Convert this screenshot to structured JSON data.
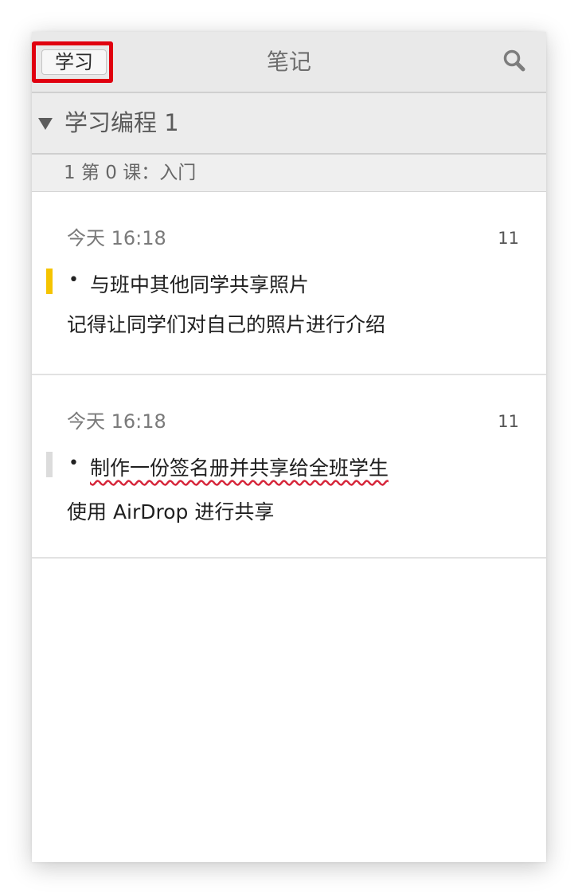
{
  "toolbar": {
    "back_label": "学习",
    "title": "笔记",
    "search_icon": "search-icon"
  },
  "group": {
    "title": "学习编程 1",
    "expanded": true
  },
  "section": {
    "label": "1  第 0 课：入门"
  },
  "notes": [
    {
      "date": "今天 16:18",
      "count": "11",
      "heading": "与班中其他同学共享照片",
      "body": "记得让同学们对自己的照片进行介绍",
      "flag_color": "#f5c400"
    },
    {
      "date": "今天 16:18",
      "count": "11",
      "heading": "制作一份签名册并共享给全班学生",
      "body": "使用 AirDrop 进行共享",
      "flag_color": "#dcdcdc"
    }
  ],
  "colors": {
    "highlight_border": "#e0000f",
    "spellcheck_underline": "#d6263a"
  }
}
